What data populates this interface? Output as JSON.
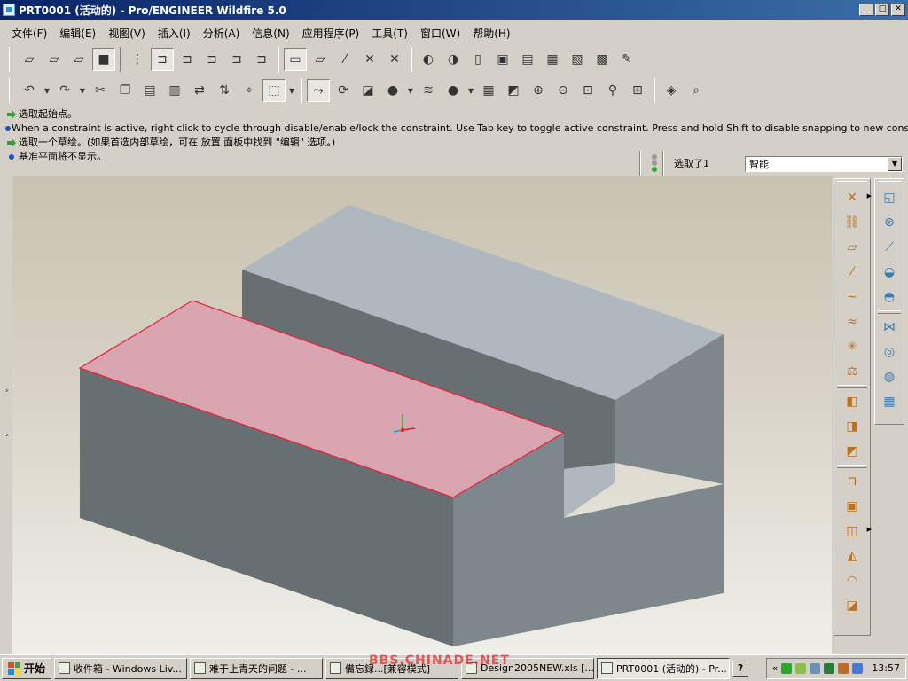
{
  "window": {
    "title": "PRT0001 (活动的) - Pro/ENGINEER Wildfire 5.0",
    "buttons": [
      "_",
      "□",
      "✕"
    ]
  },
  "menu": [
    {
      "label": "文件(F)",
      "name": "menu-file"
    },
    {
      "label": "编辑(E)",
      "name": "menu-edit"
    },
    {
      "label": "视图(V)",
      "name": "menu-view"
    },
    {
      "label": "插入(I)",
      "name": "menu-insert"
    },
    {
      "label": "分析(A)",
      "name": "menu-analysis"
    },
    {
      "label": "信息(N)",
      "name": "menu-info"
    },
    {
      "label": "应用程序(P)",
      "name": "menu-applications"
    },
    {
      "label": "工具(T)",
      "name": "menu-tools"
    },
    {
      "label": "窗口(W)",
      "name": "menu-window"
    },
    {
      "label": "帮助(H)",
      "name": "menu-help"
    }
  ],
  "toolbar1": [
    {
      "icon": "wireframe-display-icon",
      "glyph": "▱"
    },
    {
      "icon": "hidden-line-display-icon",
      "glyph": "▱"
    },
    {
      "icon": "no-hidden-display-icon",
      "glyph": "▱"
    },
    {
      "icon": "shading-display-icon",
      "glyph": "■",
      "pressed": true
    },
    {
      "icon": "sep"
    },
    {
      "icon": "model-tree-icon",
      "glyph": "⋮"
    },
    {
      "icon": "show-dimensions-icon",
      "glyph": "⊐",
      "pressed": true
    },
    {
      "icon": "show-constraints-icon",
      "glyph": "⊐"
    },
    {
      "icon": "show-grid-icon",
      "glyph": "⊐"
    },
    {
      "icon": "show-vertices-icon",
      "glyph": "⊐"
    },
    {
      "icon": "show-sketch-icon",
      "glyph": "⊐"
    },
    {
      "icon": "sep"
    },
    {
      "icon": "datum-plane-toggle-icon",
      "glyph": "▭",
      "pressed": true
    },
    {
      "icon": "datum-axis-toggle-icon",
      "glyph": "▱"
    },
    {
      "icon": "datum-point-toggle-icon",
      "glyph": "⁄"
    },
    {
      "icon": "coord-sys-toggle-icon",
      "glyph": "✕"
    },
    {
      "icon": "spin-center-toggle-icon",
      "glyph": "✕"
    },
    {
      "icon": "sep"
    },
    {
      "icon": "redraw-icon",
      "glyph": "◐"
    },
    {
      "icon": "regenerate-icon",
      "glyph": "◑"
    },
    {
      "icon": "new-file-icon",
      "glyph": "▯"
    },
    {
      "icon": "open-file-icon",
      "glyph": "▣"
    },
    {
      "icon": "browse-folder-icon",
      "glyph": "▤"
    },
    {
      "icon": "save-icon",
      "glyph": "▦"
    },
    {
      "icon": "save-copy-icon",
      "glyph": "▧"
    },
    {
      "icon": "print-icon",
      "glyph": "▩"
    },
    {
      "icon": "send-mail-icon",
      "glyph": "✎"
    }
  ],
  "toolbar2": [
    {
      "icon": "undo-icon",
      "glyph": "↶"
    },
    {
      "icon": "dd"
    },
    {
      "icon": "redo-icon",
      "glyph": "↷"
    },
    {
      "icon": "dd"
    },
    {
      "icon": "cut-icon",
      "glyph": "✂"
    },
    {
      "icon": "copy-icon",
      "glyph": "❐"
    },
    {
      "icon": "paste-icon",
      "glyph": "▤"
    },
    {
      "icon": "paste-special-icon",
      "glyph": "▥"
    },
    {
      "icon": "regenerate-model-icon",
      "glyph": "⇄"
    },
    {
      "icon": "regen-manager-icon",
      "glyph": "⇅"
    },
    {
      "icon": "find-icon",
      "glyph": "⌖"
    },
    {
      "icon": "select-box-icon",
      "glyph": "⬚",
      "pressed": true
    },
    {
      "icon": "dd"
    },
    {
      "icon": "sep"
    },
    {
      "icon": "sketch-icon",
      "glyph": "⤳",
      "pressed": true
    },
    {
      "icon": "spin-center-icon",
      "glyph": "⟳"
    },
    {
      "icon": "orient-mode-icon",
      "glyph": "◪"
    },
    {
      "icon": "appearance-icon",
      "glyph": "●"
    },
    {
      "icon": "dd"
    },
    {
      "icon": "layers-icon",
      "glyph": "≋"
    },
    {
      "icon": "color-sphere-icon",
      "glyph": "●"
    },
    {
      "icon": "dd"
    },
    {
      "icon": "saved-views-icon",
      "glyph": "▦"
    },
    {
      "icon": "reorient-icon",
      "glyph": "◩"
    },
    {
      "icon": "zoom-in-icon",
      "glyph": "⊕"
    },
    {
      "icon": "zoom-out-icon",
      "glyph": "⊖"
    },
    {
      "icon": "refit-icon",
      "glyph": "⊡"
    },
    {
      "icon": "view-manager-icon",
      "glyph": "⚲"
    },
    {
      "icon": "named-view-icon",
      "glyph": "⊞"
    },
    {
      "icon": "sep"
    },
    {
      "icon": "connect-icon",
      "glyph": "◈"
    },
    {
      "icon": "context-help-icon",
      "glyph": "⌕"
    }
  ],
  "messages": [
    {
      "icon": "arrow",
      "text": "选取起始点。"
    },
    {
      "icon": "dot",
      "text": "When a constraint is active, right click to cycle through disable/enable/lock the constraint. Use Tab key to toggle active constraint. Press and hold Shift to disable snapping to new constraints."
    },
    {
      "icon": "arrow",
      "text": "选取一个草绘。(如果首选内部草绘，可在 放置 面板中找到 \"编辑\" 选项。)"
    },
    {
      "icon": "dot",
      "text": "基准平面将不显示。"
    }
  ],
  "selection": {
    "count_label": "选取了1",
    "filter_value": "智能"
  },
  "colors": {
    "block_top": "#aeb8be",
    "block_side": "#7d878c",
    "block_dark": "#686f73",
    "selected_face": "#d8a5b1",
    "selected_edge": "#e8203a",
    "csys_x": "#e02020",
    "csys_y": "#20b020",
    "csys_z": "#20a0e0"
  },
  "right_toolbar1": [
    {
      "icon": "datum-point-icon",
      "glyph": "✕",
      "more": true
    },
    {
      "icon": "datum-chain-icon",
      "glyph": "⛓"
    },
    {
      "icon": "datum-plane-icon",
      "glyph": "▱"
    },
    {
      "icon": "datum-axis-icon",
      "glyph": "⁄"
    },
    {
      "icon": "datum-curve-icon",
      "glyph": "∼"
    },
    {
      "icon": "sketch-tool-icon",
      "glyph": "≈"
    },
    {
      "icon": "coordinate-system-icon",
      "glyph": "✳"
    },
    {
      "icon": "analysis-feature-icon",
      "glyph": "⚖"
    },
    {
      "icon": "sep"
    },
    {
      "icon": "extrude-icon",
      "glyph": "◧"
    },
    {
      "icon": "revolve-icon",
      "glyph": "◨"
    },
    {
      "icon": "sweep-icon",
      "glyph": "◩"
    },
    {
      "icon": "sep"
    },
    {
      "icon": "hole-icon",
      "glyph": "⊓"
    },
    {
      "icon": "shell-icon",
      "glyph": "▣"
    },
    {
      "icon": "rib-icon",
      "glyph": "◫",
      "more": true
    },
    {
      "icon": "draft-icon",
      "glyph": "◭"
    },
    {
      "icon": "round-icon",
      "glyph": "◠"
    },
    {
      "icon": "chamfer-icon",
      "glyph": "◪"
    }
  ],
  "right_toolbar2": [
    {
      "icon": "extrude-tool-icon",
      "glyph": "◱"
    },
    {
      "icon": "revolve-tool-icon",
      "glyph": "⊛"
    },
    {
      "icon": "variable-sweep-icon",
      "glyph": "⟋"
    },
    {
      "icon": "blend-icon",
      "glyph": "◒"
    },
    {
      "icon": "boundary-blend-icon",
      "glyph": "◓"
    },
    {
      "icon": "sep"
    },
    {
      "icon": "trim-icon",
      "glyph": "⋈"
    },
    {
      "icon": "merge-icon",
      "glyph": "◎"
    },
    {
      "icon": "intersect-icon",
      "glyph": "◍"
    },
    {
      "icon": "pattern-icon",
      "glyph": "▦"
    }
  ],
  "taskbar": {
    "start_label": "开始",
    "tasks": [
      {
        "label": "收件箱 - Windows Liv...",
        "active": false
      },
      {
        "label": "难于上青天的问题 - ...",
        "active": false
      },
      {
        "label": "備忘録...[兼容模式]",
        "active": false
      },
      {
        "label": "Design2005NEW.xls [...",
        "active": false
      },
      {
        "label": "PRT0001 (活动的) - Pr...",
        "active": true
      }
    ],
    "help_label": "?",
    "tray_label": "«",
    "clock": "13:57"
  },
  "watermark": "BBS.CHINADE.NET"
}
